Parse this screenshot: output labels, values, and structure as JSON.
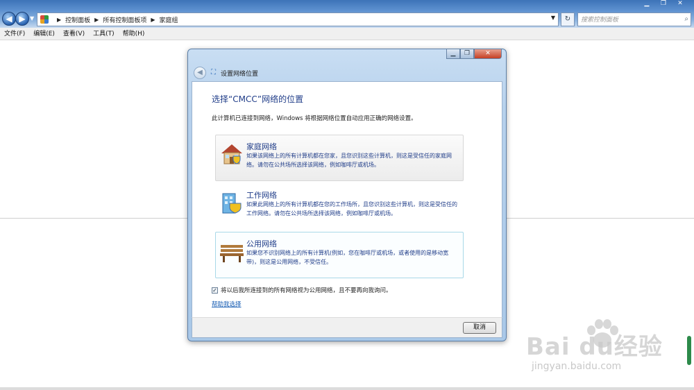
{
  "explorer": {
    "breadcrumbs": [
      "控制面板",
      "所有控制面板项",
      "家庭组"
    ],
    "search_placeholder": "搜索控制面板",
    "menu": [
      "文件(F)",
      "编辑(E)",
      "查看(V)",
      "工具(T)",
      "帮助(H)"
    ]
  },
  "dialog": {
    "title": "设置网络位置",
    "heading": "选择“CMCC”网络的位置",
    "description": "此计算机已连接到网络，Windows 将根据网络位置自动应用正确的网络设置。",
    "options": [
      {
        "title": "家庭网络",
        "desc": "如果该网络上的所有计算机都在您家，且您识别这些计算机，则这是受信任的家庭网络。请勿在公共场所选择该网络，例如咖啡厅或机场。",
        "icon": "house-icon"
      },
      {
        "title": "工作网络",
        "desc": "如果此网络上的所有计算机都在您的工作场所，且您识别这些计算机，则这是受信任的工作网络。请勿在公共场所选择该网络，例如咖啡厅或机场。",
        "icon": "office-building-icon"
      },
      {
        "title": "公用网络",
        "desc": "如果您不识别网络上的所有计算机(例如，您在咖啡厅或机场，或者使用的是移动宽带)，则这是公用网络，不受信任。",
        "icon": "park-bench-icon"
      }
    ],
    "checkbox_label": "将以后我所连接到的所有网络视为公用网络，且不要再向我询问。",
    "checkbox_checked": true,
    "help_link": "帮助我选择",
    "cancel_label": "取消"
  },
  "watermark": {
    "main": "Bai du经验",
    "sub": "jingyan.baidu.com"
  }
}
